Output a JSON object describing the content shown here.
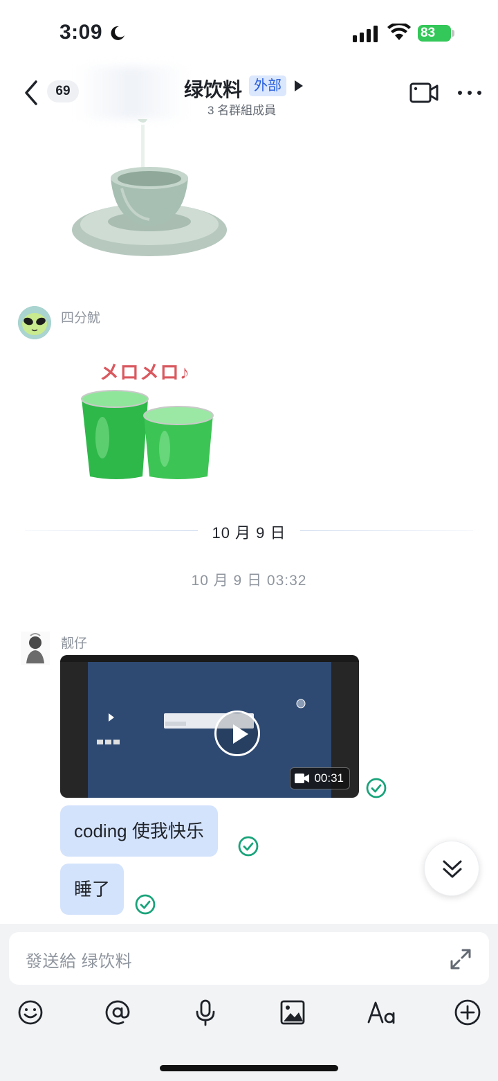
{
  "status_bar": {
    "time": "3:09",
    "battery": "83"
  },
  "header": {
    "back_label": "back",
    "unread_count": "69",
    "title": "绿饮料",
    "external_tag": "外部",
    "member_count": "3 名群組成員"
  },
  "messages": {
    "sender_1": "四分魷",
    "date_divider": "10 月 9 日",
    "timestamp": "10 月 9 日 03:32",
    "sender_2": "靓仔",
    "video_duration": "00:31",
    "bubble_1": "coding 使我快乐",
    "bubble_2": "睡了",
    "sticker_text": "メロメロ♪"
  },
  "composer": {
    "placeholder": "發送給 绿饮料"
  },
  "colors": {
    "accent": "#245bdb",
    "bubble": "#d4e3fc",
    "read_check": "#1aa37a",
    "battery": "#34c759"
  },
  "icons": [
    "moon-icon",
    "signal-icon",
    "wifi-icon",
    "back-chevron-icon",
    "video-camera-icon",
    "more-dots-icon",
    "play-icon",
    "check-circle-icon",
    "double-chevron-down-icon",
    "expand-icon",
    "emoji-icon",
    "mention-icon",
    "microphone-icon",
    "image-icon",
    "text-format-icon",
    "plus-circle-icon"
  ]
}
